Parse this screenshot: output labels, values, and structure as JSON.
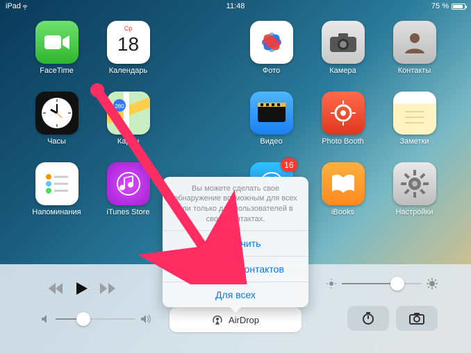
{
  "statusbar": {
    "device": "iPad",
    "time": "11:48",
    "battery_pct": "75 %"
  },
  "calendar": {
    "weekday": "Ср",
    "day": "18"
  },
  "apps": {
    "facetime": "FaceTime",
    "calendar": "Календарь",
    "photos": "Фото",
    "camera": "Камера",
    "contacts": "Контакты",
    "clock": "Часы",
    "maps": "Карты",
    "videos": "Видео",
    "photobooth": "Photo Booth",
    "notes": "Заметки",
    "reminders": "Напоминания",
    "itunes": "iTunes Store",
    "appstore": "App Store",
    "ibooks": "iBooks",
    "settings": "Настройки"
  },
  "badges": {
    "appstore": "16"
  },
  "cc": {
    "airdrop_label": "AirDrop"
  },
  "popover": {
    "message": "Вы можете сделать свое обнаружение возможным для всех или только для пользователей в своих контактах.",
    "opt_off": "Выключить",
    "opt_contacts": "Только для контактов",
    "opt_everyone": "Для всех"
  }
}
